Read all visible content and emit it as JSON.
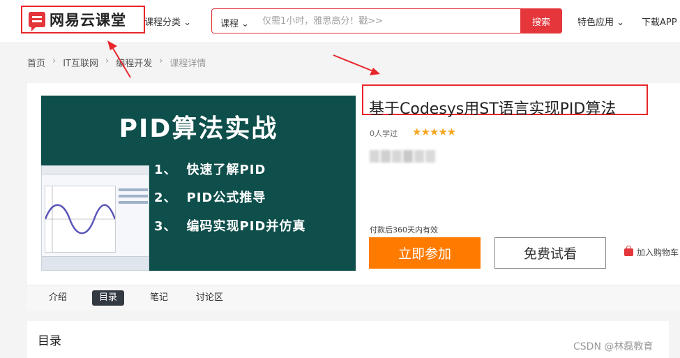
{
  "header": {
    "logo_text": "网易云课堂",
    "category_label": "课程分类",
    "search": {
      "type_label": "课程",
      "placeholder": "仅需1小时，雅思高分！戳>>",
      "button_label": "搜索"
    },
    "feature_label": "特色应用",
    "download_label": "下载APP"
  },
  "breadcrumb": [
    "首页",
    "IT互联网",
    "编程开发",
    "课程详情"
  ],
  "course": {
    "cover": {
      "title": "PID算法实战",
      "items": [
        {
          "num": "1、",
          "text": "快速了解PID"
        },
        {
          "num": "2、",
          "text": "PID公式推导"
        },
        {
          "num": "3、",
          "text": "编码实现PID并仿真"
        }
      ]
    },
    "title": "基于Codesys用ST语言实现PID算法",
    "learners": "0人学过",
    "rating_stars": "★★★★★",
    "rating_value": 4.5,
    "validity": "付款后360天内有效",
    "join_label": "立即参加",
    "trial_label": "免费试看",
    "cart_label": "加入购物车"
  },
  "tabs": [
    {
      "label": "介绍",
      "active": false
    },
    {
      "label": "目录",
      "active": true
    },
    {
      "label": "笔记",
      "active": false
    },
    {
      "label": "讨论区",
      "active": false
    }
  ],
  "toc": {
    "title": "目录"
  },
  "watermark": "CSDN @林磊教育",
  "colors": {
    "brand_red": "#e4363b",
    "accent_orange": "#ff7b00",
    "annotation_red": "#e8262c",
    "cover_bg": "#0e4e4b"
  }
}
